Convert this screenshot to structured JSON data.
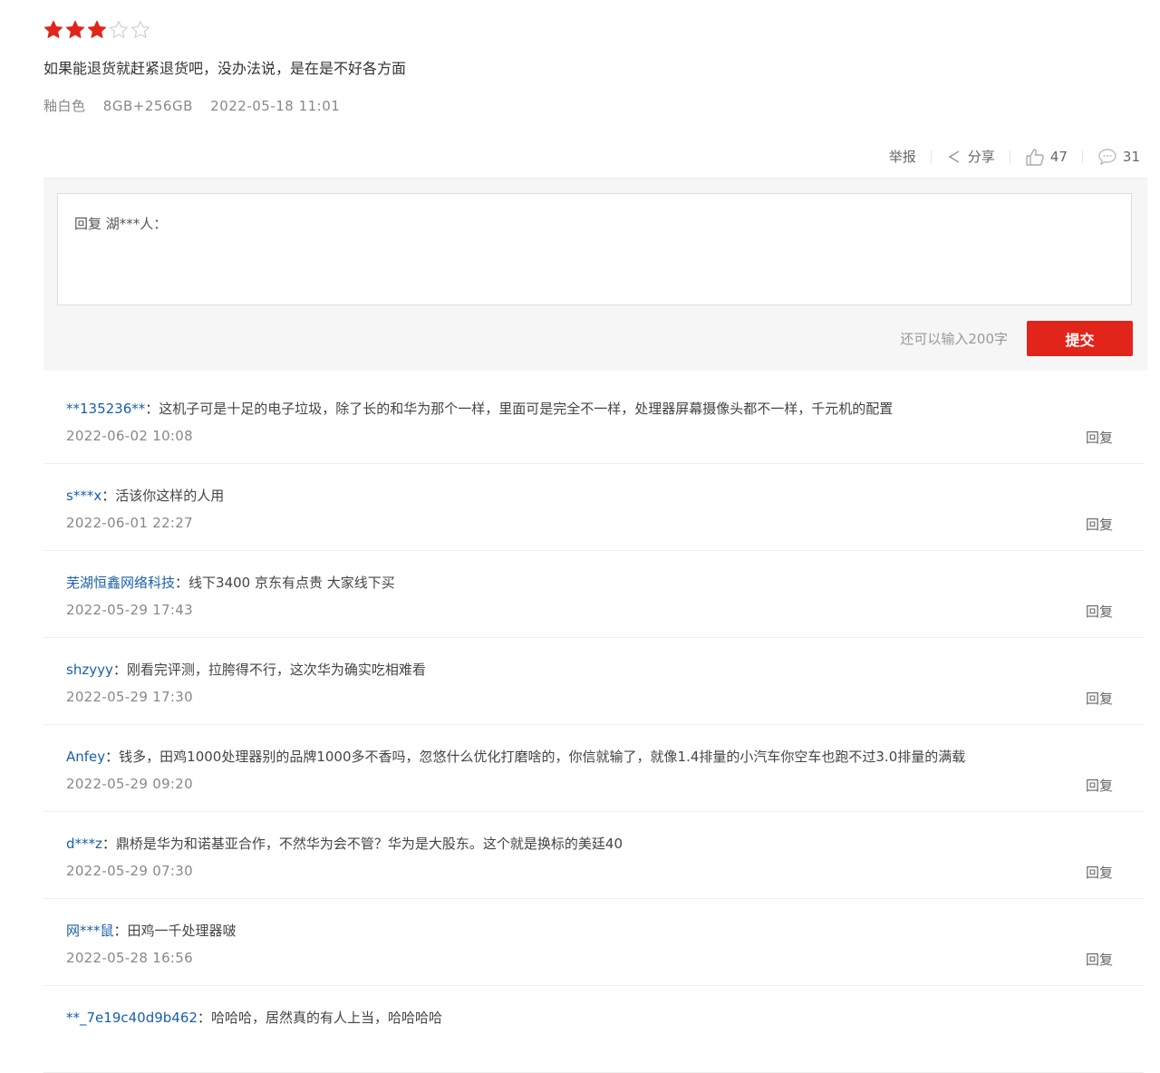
{
  "review": {
    "rating": 3,
    "max_rating": 5,
    "text": "如果能退货就赶紧退货吧，没办法说，是在是不好各方面",
    "color_variant": "釉白色",
    "spec": "8GB+256GB",
    "datetime": "2022-05-18 11:01",
    "actions": {
      "report_label": "举报",
      "share_label": "分享",
      "like_count": "47",
      "comment_count": "31"
    }
  },
  "reply_form": {
    "placeholder": "回复 湖***人：",
    "remaining_text": "还可以输入200字",
    "submit_label": "提交"
  },
  "comments": [
    {
      "user": "**135236**",
      "sep": "：",
      "text": "这机子可是十足的电子垃圾，除了长的和华为那个一样，里面可是完全不一样，处理器屏幕摄像头都不一样，千元机的配置",
      "time": "2022-06-02 10:08",
      "reply_label": "回复"
    },
    {
      "user": "s***x",
      "sep": "：",
      "text": "活该你这样的人用",
      "time": "2022-06-01 22:27",
      "reply_label": "回复"
    },
    {
      "user": "芜湖恒鑫网络科技",
      "sep": "：",
      "text": "线下3400 京东有点贵 大家线下买",
      "time": "2022-05-29 17:43",
      "reply_label": "回复"
    },
    {
      "user": "shzyyy",
      "sep": "：",
      "text": "刚看完评测，拉胯得不行，这次华为确实吃相难看",
      "time": "2022-05-29 17:30",
      "reply_label": "回复"
    },
    {
      "user": "Anfey",
      "sep": "：",
      "text": "钱多，田鸡1000处理器别的品牌1000多不香吗，忽悠什么优化打磨啥的，你信就输了，就像1.4排量的小汽车你空车也跑不过3.0排量的满载",
      "time": "2022-05-29 09:20",
      "reply_label": "回复"
    },
    {
      "user": "d***z",
      "sep": "：",
      "text": "鼎桥是华为和诺基亚合作，不然华为会不管？华为是大股东。这个就是换标的美廷40",
      "time": "2022-05-29 07:30",
      "reply_label": "回复"
    },
    {
      "user": "网***鼠",
      "sep": "：",
      "text": "田鸡一千处理器啵",
      "time": "2022-05-28 16:56",
      "reply_label": "回复"
    },
    {
      "user": "**_7e19c40d9b462",
      "sep": "：",
      "text": "哈哈哈，居然真的有人上当，哈哈哈哈",
      "time": "",
      "reply_label": ""
    }
  ],
  "colors": {
    "star_filled": "#e1251b",
    "star_empty": "#d0d0d0",
    "accent": "#e1251b",
    "username": "#1a5fa8"
  },
  "icons": {
    "share": "share-icon",
    "like": "thumbs-up-icon",
    "comment": "comment-bubble-icon",
    "star": "star-icon"
  }
}
